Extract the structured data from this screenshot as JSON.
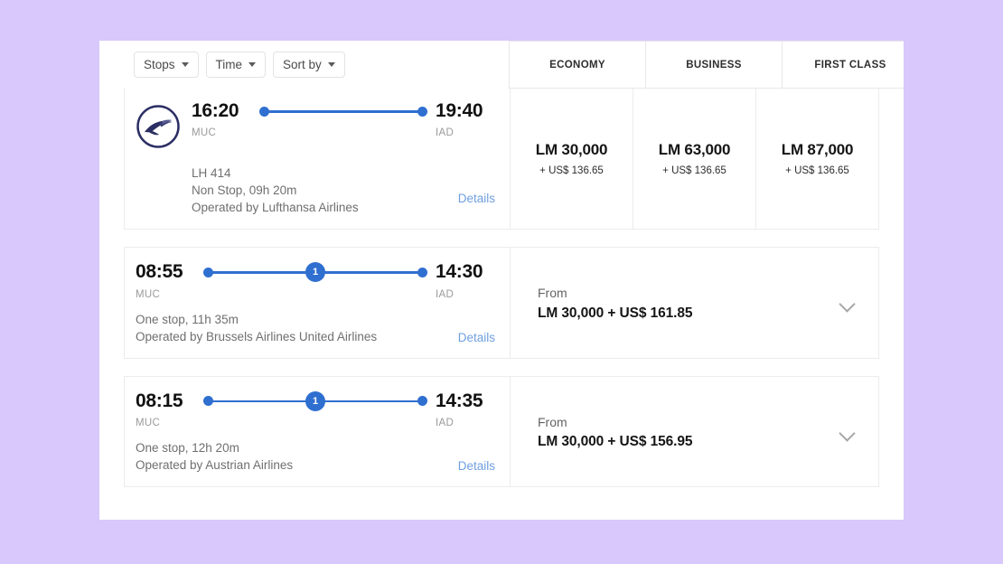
{
  "filters": [
    {
      "label": "Stops",
      "icon": "chevron-down-icon"
    },
    {
      "label": "Time",
      "icon": "chevron-down-icon"
    },
    {
      "label": "Sort by",
      "icon": "chevron-down-icon"
    }
  ],
  "fare_classes": [
    "ECONOMY",
    "BUSINESS",
    "FIRST CLASS"
  ],
  "colors": {
    "page_background": "#d8c8fb",
    "panel_background": "#ffffff",
    "timeline_blue": "#2f6fd0",
    "link_blue": "#6f9fe0",
    "logo_navy": "#2b2e63"
  },
  "flights": [
    {
      "airline_logo": "lufthansa-crane-logo",
      "depart_time": "16:20",
      "depart_airport": "MUC",
      "arrive_time": "19:40",
      "arrive_airport": "IAD",
      "stops_badge": null,
      "flight_number": "LH 414",
      "duration_line": "Non Stop, 09h 20m",
      "operated_by": "Operated by Lufthansa Airlines",
      "details_label": "Details",
      "layout": "fare-columns",
      "fares": [
        {
          "miles": "LM 30,000",
          "cash": "+ US$ 136.65"
        },
        {
          "miles": "LM 63,000",
          "cash": "+ US$ 136.65"
        },
        {
          "miles": "LM 87,000",
          "cash": "+ US$ 136.65"
        }
      ]
    },
    {
      "airline_logo": null,
      "depart_time": "08:55",
      "depart_airport": "MUC",
      "arrive_time": "14:30",
      "arrive_airport": "IAD",
      "stops_badge": "1",
      "flight_number": null,
      "duration_line": "One stop, 11h 35m",
      "operated_by": "Operated by Brussels Airlines United Airlines",
      "details_label": "Details",
      "layout": "from-price",
      "from_label": "From",
      "from_price": "LM 30,000 + US$ 161.85",
      "expand_icon": "chevron-down-icon"
    },
    {
      "airline_logo": null,
      "depart_time": "08:15",
      "depart_airport": "MUC",
      "arrive_time": "14:35",
      "arrive_airport": "IAD",
      "stops_badge": "1",
      "flight_number": null,
      "duration_line": "One stop, 12h 20m",
      "operated_by": "Operated by Austrian Airlines",
      "details_label": "Details",
      "layout": "from-price",
      "from_label": "From",
      "from_price": "LM 30,000 + US$ 156.95",
      "expand_icon": "chevron-down-icon"
    }
  ]
}
